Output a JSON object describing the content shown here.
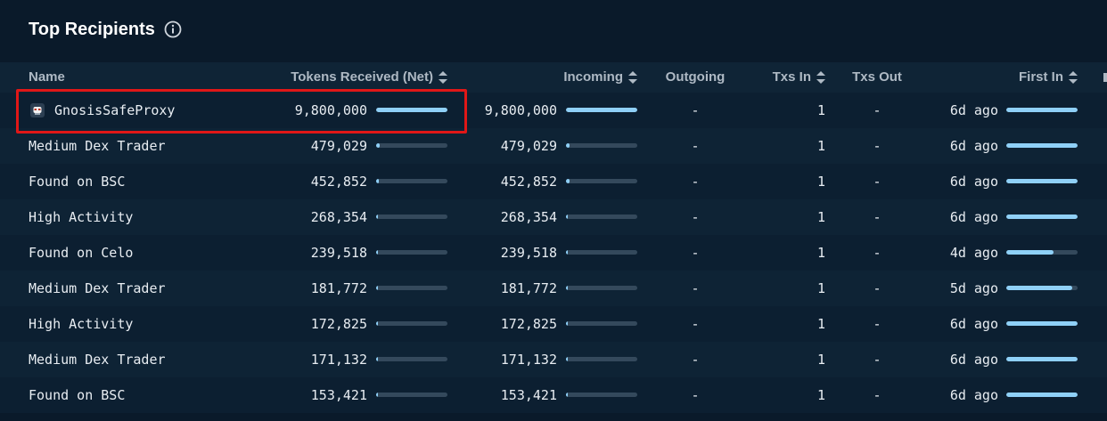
{
  "panel": {
    "title": "Top Recipients",
    "info_icon": "info-icon"
  },
  "columns": {
    "name": "Name",
    "tokens": "Tokens Received (Net)",
    "incoming": "Incoming",
    "outgoing": "Outgoing",
    "txs_in": "Txs In",
    "txs_out": "Txs Out",
    "first_in": "First In"
  },
  "rows": [
    {
      "name": "GnosisSafeProxy",
      "tokens": "9,800,000",
      "tokens_pct": 100,
      "incoming": "9,800,000",
      "incoming_pct": 100,
      "outgoing": "-",
      "txs_in": "1",
      "txs_out": "-",
      "first_in": "6d ago",
      "first_pct": 100,
      "icon": "safe-avatar-icon"
    },
    {
      "name": "Medium Dex Trader",
      "tokens": "479,029",
      "tokens_pct": 5,
      "incoming": "479,029",
      "incoming_pct": 5,
      "outgoing": "-",
      "txs_in": "1",
      "txs_out": "-",
      "first_in": "6d ago",
      "first_pct": 100
    },
    {
      "name": "Found on BSC",
      "tokens": "452,852",
      "tokens_pct": 4,
      "incoming": "452,852",
      "incoming_pct": 5,
      "outgoing": "-",
      "txs_in": "1",
      "txs_out": "-",
      "first_in": "6d ago",
      "first_pct": 100
    },
    {
      "name": "High Activity",
      "tokens": "268,354",
      "tokens_pct": 3,
      "incoming": "268,354",
      "incoming_pct": 3,
      "outgoing": "-",
      "txs_in": "1",
      "txs_out": "-",
      "first_in": "6d ago",
      "first_pct": 100
    },
    {
      "name": "Found on Celo",
      "tokens": "239,518",
      "tokens_pct": 2,
      "incoming": "239,518",
      "incoming_pct": 2,
      "outgoing": "-",
      "txs_in": "1",
      "txs_out": "-",
      "first_in": "4d ago",
      "first_pct": 66
    },
    {
      "name": "Medium Dex Trader",
      "tokens": "181,772",
      "tokens_pct": 2,
      "incoming": "181,772",
      "incoming_pct": 2,
      "outgoing": "-",
      "txs_in": "1",
      "txs_out": "-",
      "first_in": "5d ago",
      "first_pct": 93
    },
    {
      "name": "High Activity",
      "tokens": "172,825",
      "tokens_pct": 2,
      "incoming": "172,825",
      "incoming_pct": 2,
      "outgoing": "-",
      "txs_in": "1",
      "txs_out": "-",
      "first_in": "6d ago",
      "first_pct": 100
    },
    {
      "name": "Medium Dex Trader",
      "tokens": "171,132",
      "tokens_pct": 2,
      "incoming": "171,132",
      "incoming_pct": 2,
      "outgoing": "-",
      "txs_in": "1",
      "txs_out": "-",
      "first_in": "6d ago",
      "first_pct": 100
    },
    {
      "name": "Found on BSC",
      "tokens": "153,421",
      "tokens_pct": 2,
      "incoming": "153,421",
      "incoming_pct": 2,
      "outgoing": "-",
      "txs_in": "1",
      "txs_out": "-",
      "first_in": "6d ago",
      "first_pct": 100
    }
  ],
  "colors": {
    "background": "#0a1a2a",
    "bar_fill": "#8fd0f7",
    "bar_track": "#34495c",
    "highlight": "#e01717"
  }
}
